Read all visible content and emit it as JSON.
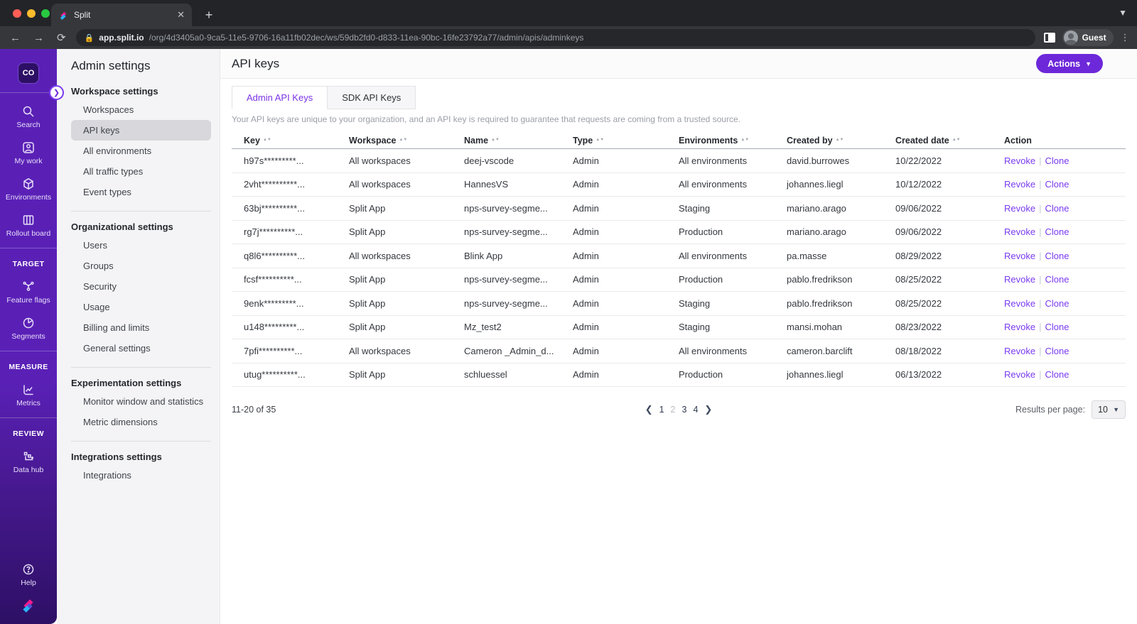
{
  "browser": {
    "tab_title": "Split",
    "url_domain": "app.split.io",
    "url_path": "/org/4d3405a0-9ca5-11e5-9706-16a11fb02dec/ws/59db2fd0-d833-11ea-90bc-16fe23792a77/admin/apis/adminkeys",
    "profile_label": "Guest"
  },
  "sidebar": {
    "workspace_badge": "CO",
    "search": "Search",
    "my_work": "My work",
    "environments": "Environments",
    "rollout_board": "Rollout board",
    "section_target": "TARGET",
    "feature_flags": "Feature flags",
    "segments": "Segments",
    "section_measure": "MEASURE",
    "metrics": "Metrics",
    "section_review": "REVIEW",
    "data_hub": "Data hub",
    "help": "Help"
  },
  "nav": {
    "title": "Admin settings",
    "workspace_heading": "Workspace settings",
    "workspaces": "Workspaces",
    "api_keys": "API keys",
    "all_environments": "All environments",
    "all_traffic_types": "All traffic types",
    "event_types": "Event types",
    "org_heading": "Organizational settings",
    "users": "Users",
    "groups": "Groups",
    "security": "Security",
    "usage": "Usage",
    "billing": "Billing and limits",
    "general": "General settings",
    "exp_heading": "Experimentation settings",
    "monitor": "Monitor window and statistics",
    "metric_dimensions": "Metric dimensions",
    "integrations_heading": "Integrations settings",
    "integrations": "Integrations"
  },
  "main": {
    "page_title": "API keys",
    "actions_button": "Actions",
    "tab_admin": "Admin API Keys",
    "tab_sdk": "SDK API Keys",
    "description": "Your API keys are unique to your organization, and an API key is required to guarantee that requests are coming from a trusted source.",
    "table": {
      "columns": [
        "Key",
        "Workspace",
        "Name",
        "Type",
        "Environments",
        "Created by",
        "Created date",
        "Action"
      ],
      "actions": {
        "revoke": "Revoke",
        "clone": "Clone"
      },
      "rows": [
        {
          "key": "h97s*********...",
          "workspace": "All workspaces",
          "name": "deej-vscode",
          "type": "Admin",
          "environments": "All environments",
          "created_by": "david.burrowes",
          "created_date": "10/22/2022"
        },
        {
          "key": "2vht**********...",
          "workspace": "All workspaces",
          "name": "HannesVS",
          "type": "Admin",
          "environments": "All environments",
          "created_by": "johannes.liegl",
          "created_date": "10/12/2022"
        },
        {
          "key": "63bj**********...",
          "workspace": "Split App",
          "name": "nps-survey-segme...",
          "type": "Admin",
          "environments": "Staging",
          "created_by": "mariano.arago",
          "created_date": "09/06/2022"
        },
        {
          "key": "rg7j**********...",
          "workspace": "Split App",
          "name": "nps-survey-segme...",
          "type": "Admin",
          "environments": "Production",
          "created_by": "mariano.arago",
          "created_date": "09/06/2022"
        },
        {
          "key": "q8l6**********...",
          "workspace": "All workspaces",
          "name": "Blink App",
          "type": "Admin",
          "environments": "All environments",
          "created_by": "pa.masse",
          "created_date": "08/29/2022"
        },
        {
          "key": "fcsf**********...",
          "workspace": "Split App",
          "name": "nps-survey-segme...",
          "type": "Admin",
          "environments": "Production",
          "created_by": "pablo.fredrikson",
          "created_date": "08/25/2022"
        },
        {
          "key": "9enk*********...",
          "workspace": "Split App",
          "name": "nps-survey-segme...",
          "type": "Admin",
          "environments": "Staging",
          "created_by": "pablo.fredrikson",
          "created_date": "08/25/2022"
        },
        {
          "key": "u148*********...",
          "workspace": "Split App",
          "name": "Mz_test2",
          "type": "Admin",
          "environments": "Staging",
          "created_by": "mansi.mohan",
          "created_date": "08/23/2022"
        },
        {
          "key": "7pfi**********...",
          "workspace": "All workspaces",
          "name": "Cameron _Admin_d...",
          "type": "Admin",
          "environments": "All environments",
          "created_by": "cameron.barclift",
          "created_date": "08/18/2022"
        },
        {
          "key": "utug**********...",
          "workspace": "Split App",
          "name": "schluessel",
          "type": "Admin",
          "environments": "Production",
          "created_by": "johannes.liegl",
          "created_date": "06/13/2022"
        }
      ]
    },
    "pagination": {
      "range_text": "11-20 of 35",
      "page_1": "1",
      "page_2": "2",
      "page_3": "3",
      "page_4": "4",
      "current_page": "2",
      "results_per_page_label": "Results per page:",
      "results_per_page_value": "10"
    }
  },
  "colors": {
    "sidebar_purple": "#5a20b6",
    "sidebar_bottom": "#2d1065",
    "accent_purple": "#6d28d9",
    "link_purple": "#7a3bf0",
    "selected_nav_bg": "#d7d7dc"
  }
}
